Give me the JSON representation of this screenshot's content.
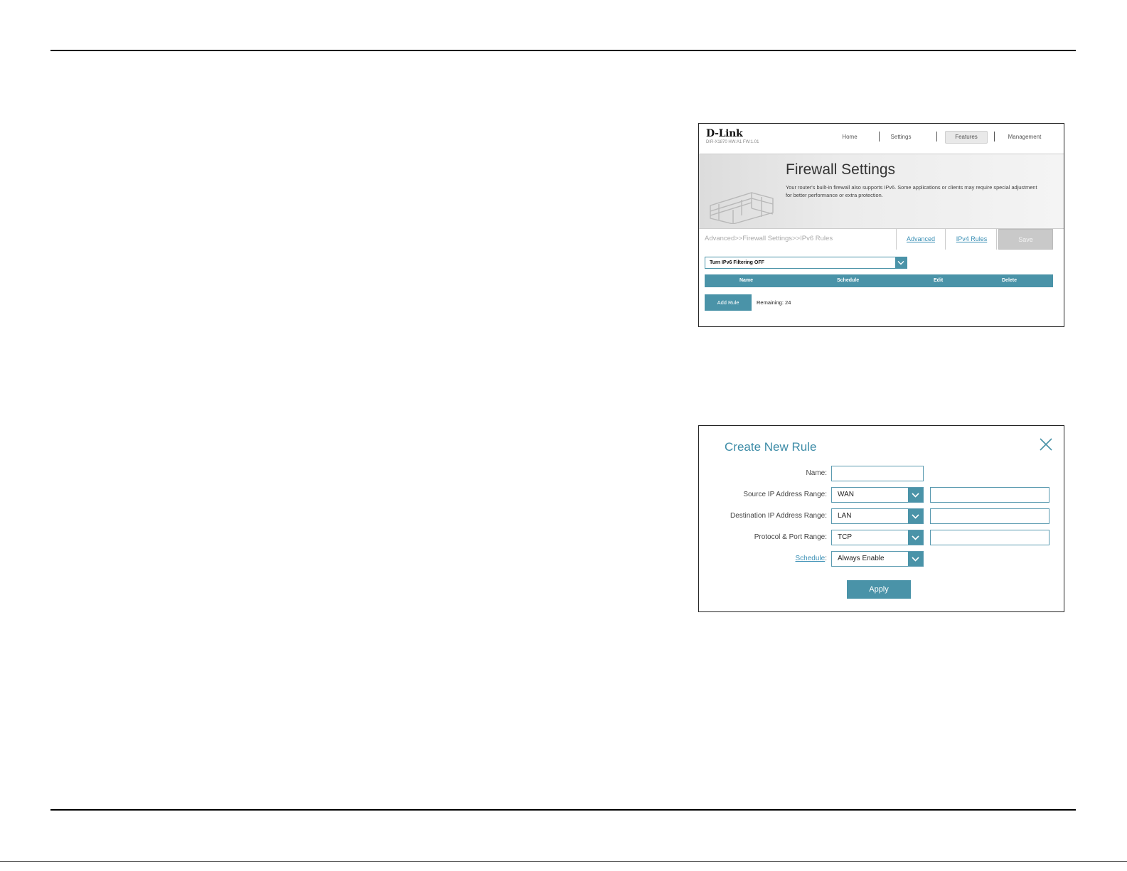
{
  "router": {
    "logo": "D-Link",
    "model": "DIR-X1870 HW:A1 FW:1.01",
    "nav": [
      "Home",
      "Settings",
      "Features",
      "Management"
    ],
    "banner_title": "Firewall Settings",
    "banner_desc": "Your router's built-in firewall also supports IPv6. Some applications or clients may require special adjustment for better performance or extra protection.",
    "breadcrumb": "Advanced>>Firewall Settings>>IPv6 Rules",
    "tab_advanced": "Advanced",
    "tab_ipv4": "IPv4 Rules",
    "save": "Save",
    "filter_select": "Turn IPv6 Filtering OFF",
    "columns": [
      "Name",
      "Schedule",
      "Edit",
      "Delete"
    ],
    "add_rule": "Add Rule",
    "remaining": "Remaining: 24"
  },
  "modal": {
    "title": "Create New Rule",
    "name_label": "Name:",
    "source_label": "Source IP Address Range:",
    "source_value": "WAN",
    "dest_label": "Destination IP Address Range:",
    "dest_value": "LAN",
    "protocol_label": "Protocol & Port Range:",
    "protocol_value": "TCP",
    "schedule_label": "Schedule",
    "schedule_value": "Always Enable",
    "apply": "Apply"
  },
  "colors": {
    "accent": "#4a93a8",
    "link": "#3a8fb5",
    "title": "#3d8ca7"
  },
  "icons": [
    "chevron-down-icon",
    "close-icon",
    "brick-wall-icon"
  ]
}
